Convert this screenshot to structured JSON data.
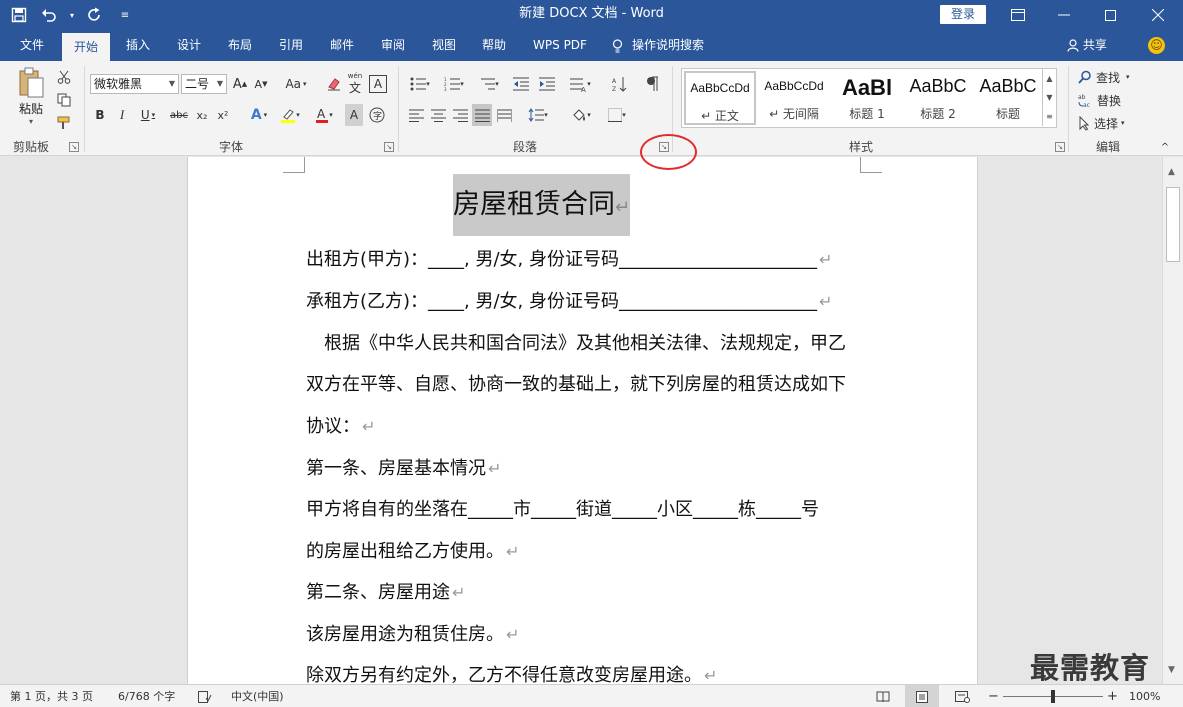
{
  "window": {
    "title": "新建 DOCX 文档 - Word",
    "login_label": "登录",
    "qat": {
      "save_icon": "save-icon",
      "undo_icon": "undo-icon",
      "redo_icon": "redo-icon",
      "customize_icon": "customize-icon"
    }
  },
  "tabs": [
    {
      "label": "文件"
    },
    {
      "label": "开始"
    },
    {
      "label": "插入"
    },
    {
      "label": "设计"
    },
    {
      "label": "布局"
    },
    {
      "label": "引用"
    },
    {
      "label": "邮件"
    },
    {
      "label": "审阅"
    },
    {
      "label": "视图"
    },
    {
      "label": "帮助"
    },
    {
      "label": "WPS PDF"
    },
    {
      "label": "操作说明搜索"
    }
  ],
  "active_tab": "开始",
  "share_label": "共享",
  "ribbon": {
    "clipboard": {
      "label": "剪贴板",
      "paste_label": "粘贴"
    },
    "font": {
      "label": "字体",
      "font_name": "微软雅黑",
      "font_size": "二号",
      "change_case": "Aa",
      "bold": "B",
      "italic": "I",
      "underline": "U",
      "strike": "abc",
      "subscript": "x₂",
      "superscript": "x²",
      "phonetic": "wén",
      "char_border": "A"
    },
    "paragraph": {
      "label": "段落"
    },
    "styles": {
      "label": "样式",
      "items": [
        {
          "sample": "AaBbCcDd",
          "name": "↵ 正文"
        },
        {
          "sample": "AaBbCcDd",
          "name": "↵ 无间隔"
        },
        {
          "sample": "AaBl",
          "name": "标题 1"
        },
        {
          "sample": "AaBbC",
          "name": "标题 2"
        },
        {
          "sample": "AaBbC",
          "name": "标题"
        }
      ]
    },
    "editing": {
      "label": "编辑",
      "find": "查找",
      "replace": "替换",
      "select": "选择"
    }
  },
  "document": {
    "title": "房屋租赁合同",
    "lines": [
      "出租方(甲方)：____, 男/女, 身份证号码______________________",
      "承租方(乙方)：____, 男/女, 身份证号码______________________",
      "　根据《中华人民共和国合同法》及其他相关法律、法规规定，甲乙",
      "双方在平等、自愿、协商一致的基础上，就下列房屋的租赁达成如下",
      "协议：",
      "第一条、房屋基本情况",
      "甲方将自有的坐落在_____市_____街道_____小区_____栋_____号",
      "的房屋出租给乙方使用。",
      "第二条、房屋用途",
      "该房屋用途为租赁住房。",
      "除双方另有约定外，乙方不得任意改变房屋用途。"
    ],
    "line_end_marks": [
      true,
      true,
      false,
      false,
      true,
      true,
      false,
      true,
      true,
      true,
      true
    ]
  },
  "status": {
    "page": "第 1 页，共 3 页",
    "words": "6/768 个字",
    "language": "中文(中国)",
    "zoom": "100%",
    "zoom_fraction": 0.5
  },
  "watermark": "最需教育"
}
